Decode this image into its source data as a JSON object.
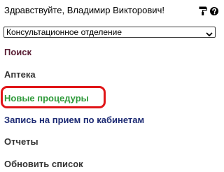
{
  "header": {
    "greeting": "Здравствуйте, Владимир Викторович!",
    "icons": [
      "paint-roller-icon",
      "help-icon"
    ]
  },
  "department_select": {
    "selected": "Консультационное отделение"
  },
  "menu": {
    "search": "Поиск",
    "pharmacy": "Аптека",
    "new_procedures": "Новые процедуры",
    "appointment": "Запись на прием по кабинетам",
    "reports": "Отчеты",
    "refresh": "Обновить список"
  },
  "colors": {
    "search": "#5a1f35",
    "default": "#333333",
    "new_procedures": "#2e9a3a",
    "appointment": "#1c2a73",
    "highlight": "#e01518"
  }
}
